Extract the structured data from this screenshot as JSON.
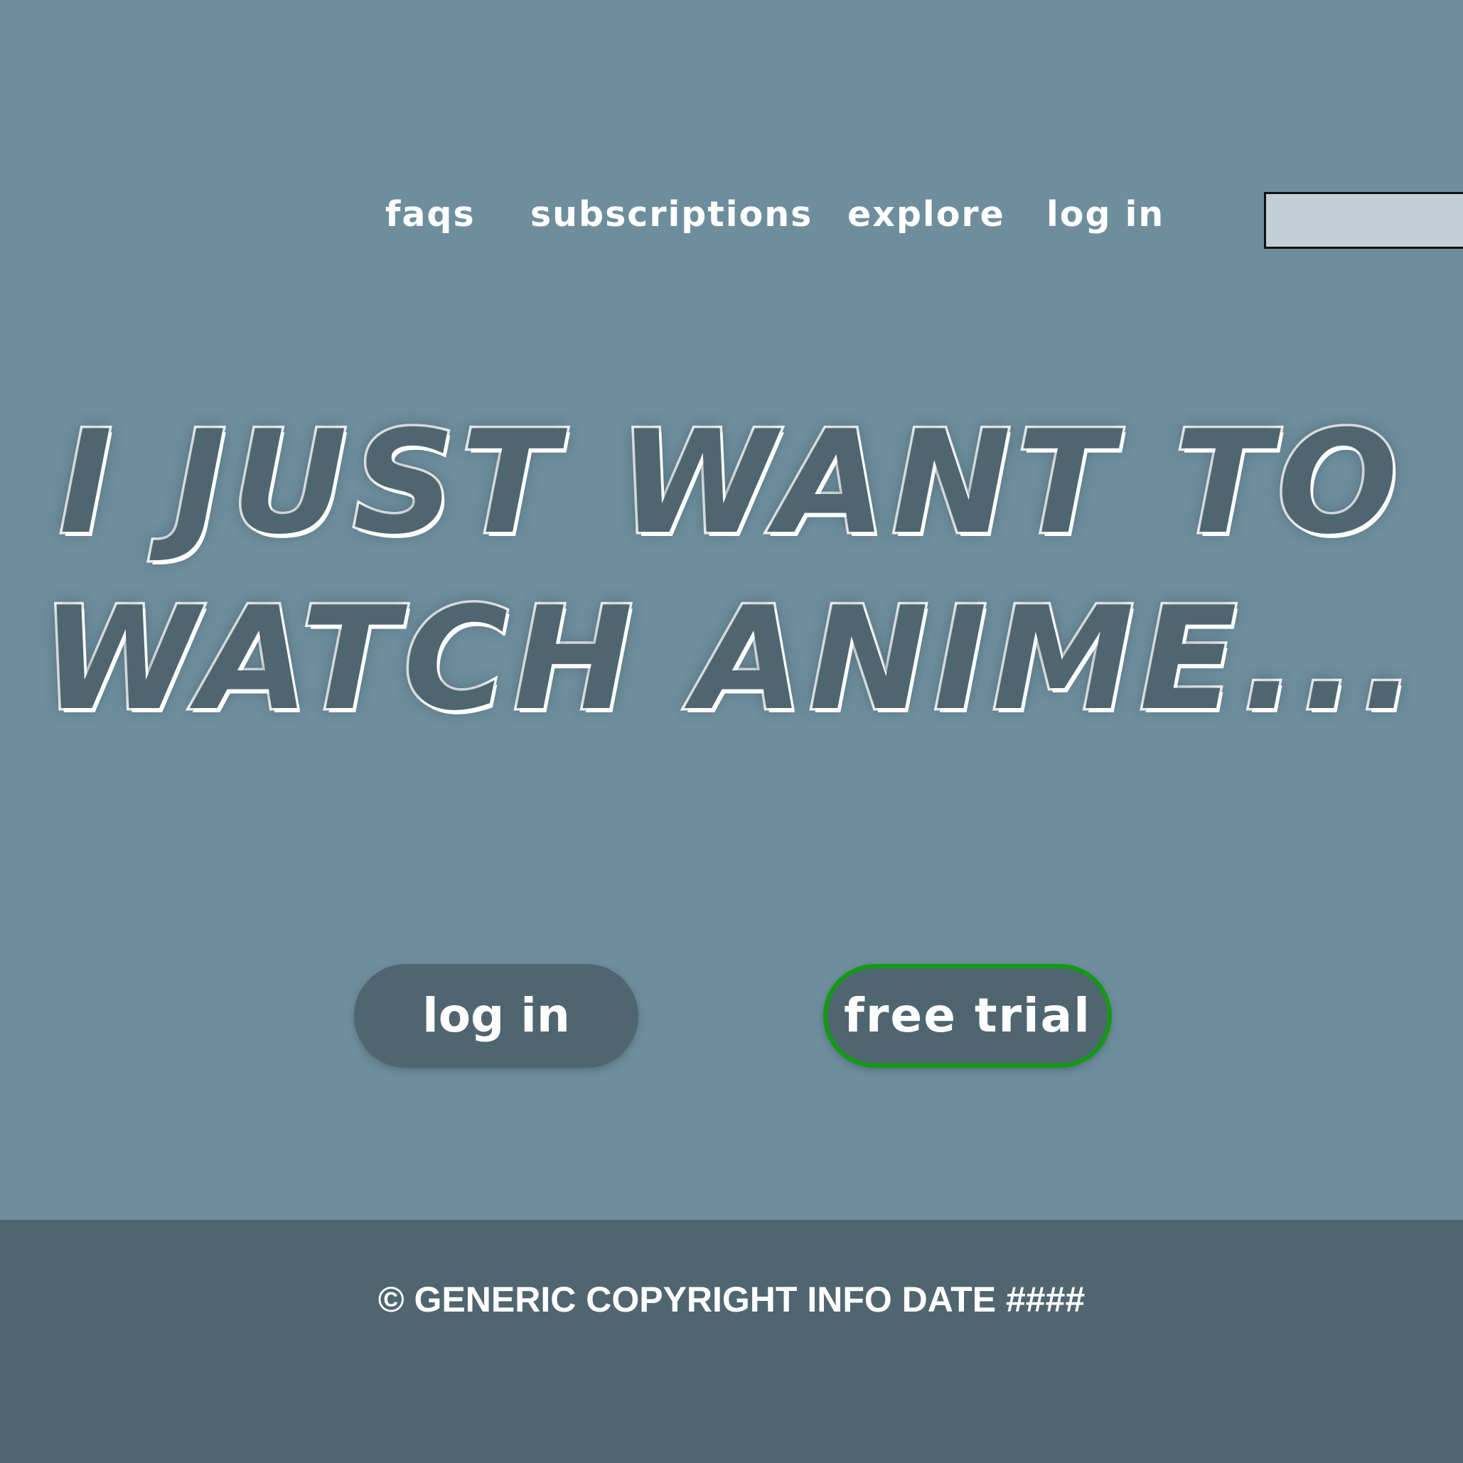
{
  "nav": {
    "items": [
      {
        "label": "faqs"
      },
      {
        "label": "subscriptions"
      },
      {
        "label": "explore"
      },
      {
        "label": "log in"
      }
    ],
    "search": {
      "value": "",
      "placeholder": ""
    }
  },
  "hero": {
    "line1": "I JUST WANT TO",
    "line2": "WATCH ANIME..."
  },
  "actions": {
    "login_label": "log in",
    "trial_label": "free trial"
  },
  "footer": {
    "copyright": "© GENERIC COPYRIGHT INFO DATE ####"
  },
  "colors": {
    "background": "#6e8e9d",
    "footer_background": "#4f6670",
    "button_background": "#4f6670",
    "trial_border": "#129a12",
    "search_background": "#c2d0d6",
    "text": "#ffffff"
  }
}
